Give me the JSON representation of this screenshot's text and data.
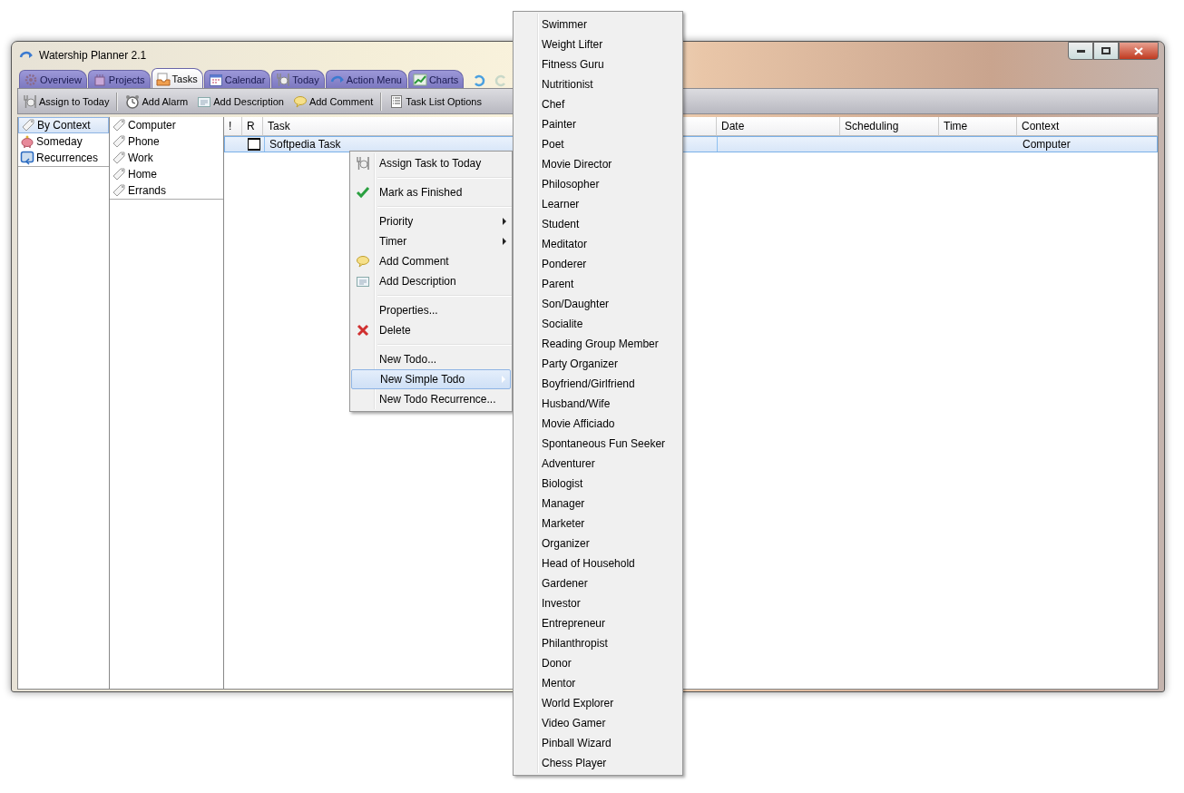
{
  "window": {
    "title": "Watership Planner 2.1"
  },
  "tabs": [
    {
      "label": "Overview",
      "selected": false
    },
    {
      "label": "Projects",
      "selected": false
    },
    {
      "label": "Tasks",
      "selected": true
    },
    {
      "label": "Calendar",
      "selected": false
    },
    {
      "label": "Today",
      "selected": false
    },
    {
      "label": "Action Menu",
      "selected": false
    },
    {
      "label": "Charts",
      "selected": false
    }
  ],
  "toolbar": [
    {
      "label": "Assign to Today"
    },
    {
      "label": "Add Alarm"
    },
    {
      "label": "Add Description"
    },
    {
      "label": "Add Comment"
    },
    {
      "label": "Task List Options"
    }
  ],
  "views": [
    {
      "label": "By Context",
      "selected": true
    },
    {
      "label": "Someday",
      "selected": false
    },
    {
      "label": "Recurrences",
      "selected": false
    }
  ],
  "contexts": [
    {
      "label": "Computer"
    },
    {
      "label": "Phone"
    },
    {
      "label": "Work"
    },
    {
      "label": "Home"
    },
    {
      "label": "Errands"
    }
  ],
  "table": {
    "columns": [
      "!",
      "R",
      "Task",
      "Date",
      "Scheduling",
      "Time",
      "Context"
    ],
    "rows": [
      {
        "selected": true,
        "task": "Softpedia Task",
        "context": "Computer"
      }
    ]
  },
  "context_menu": [
    {
      "kind": "item",
      "label": "Assign Task to Today",
      "has_submenu": false,
      "selected": false
    },
    {
      "kind": "separator"
    },
    {
      "kind": "item",
      "label": "Mark as Finished",
      "has_submenu": false,
      "selected": false
    },
    {
      "kind": "separator"
    },
    {
      "kind": "item",
      "label": "Priority",
      "has_submenu": true,
      "selected": false
    },
    {
      "kind": "item",
      "label": "Timer",
      "has_submenu": true,
      "selected": false
    },
    {
      "kind": "item",
      "label": "Add Comment",
      "has_submenu": false,
      "selected": false
    },
    {
      "kind": "item",
      "label": "Add Description",
      "has_submenu": false,
      "selected": false
    },
    {
      "kind": "separator"
    },
    {
      "kind": "item",
      "label": "Properties...",
      "has_submenu": false,
      "selected": false
    },
    {
      "kind": "item",
      "label": "Delete",
      "has_submenu": false,
      "selected": false
    },
    {
      "kind": "separator"
    },
    {
      "kind": "item",
      "label": "New Todo...",
      "has_submenu": false,
      "selected": false
    },
    {
      "kind": "item",
      "label": "New Simple Todo",
      "has_submenu": true,
      "selected": true
    },
    {
      "kind": "item",
      "label": "New Todo Recurrence...",
      "has_submenu": false,
      "selected": false
    }
  ],
  "submenu": [
    "Swimmer",
    "Weight Lifter",
    "Fitness Guru",
    "Nutritionist",
    "Chef",
    "Painter",
    "Poet",
    "Movie Director",
    "Philosopher",
    "Learner",
    "Student",
    "Meditator",
    "Ponderer",
    "Parent",
    "Son/Daughter",
    "Socialite",
    "Reading Group Member",
    "Party Organizer",
    "Boyfriend/Girlfriend",
    "Husband/Wife",
    "Movie Afficiado",
    "Spontaneous Fun Seeker",
    "Adventurer",
    "Biologist",
    "Manager",
    "Marketer",
    "Organizer",
    "Head of Household",
    "Gardener",
    "Investor",
    "Entrepreneur",
    "Philanthropist",
    "Donor",
    "Mentor",
    "World Explorer",
    "Video Gamer",
    "Pinball Wizard",
    "Chess Player"
  ]
}
